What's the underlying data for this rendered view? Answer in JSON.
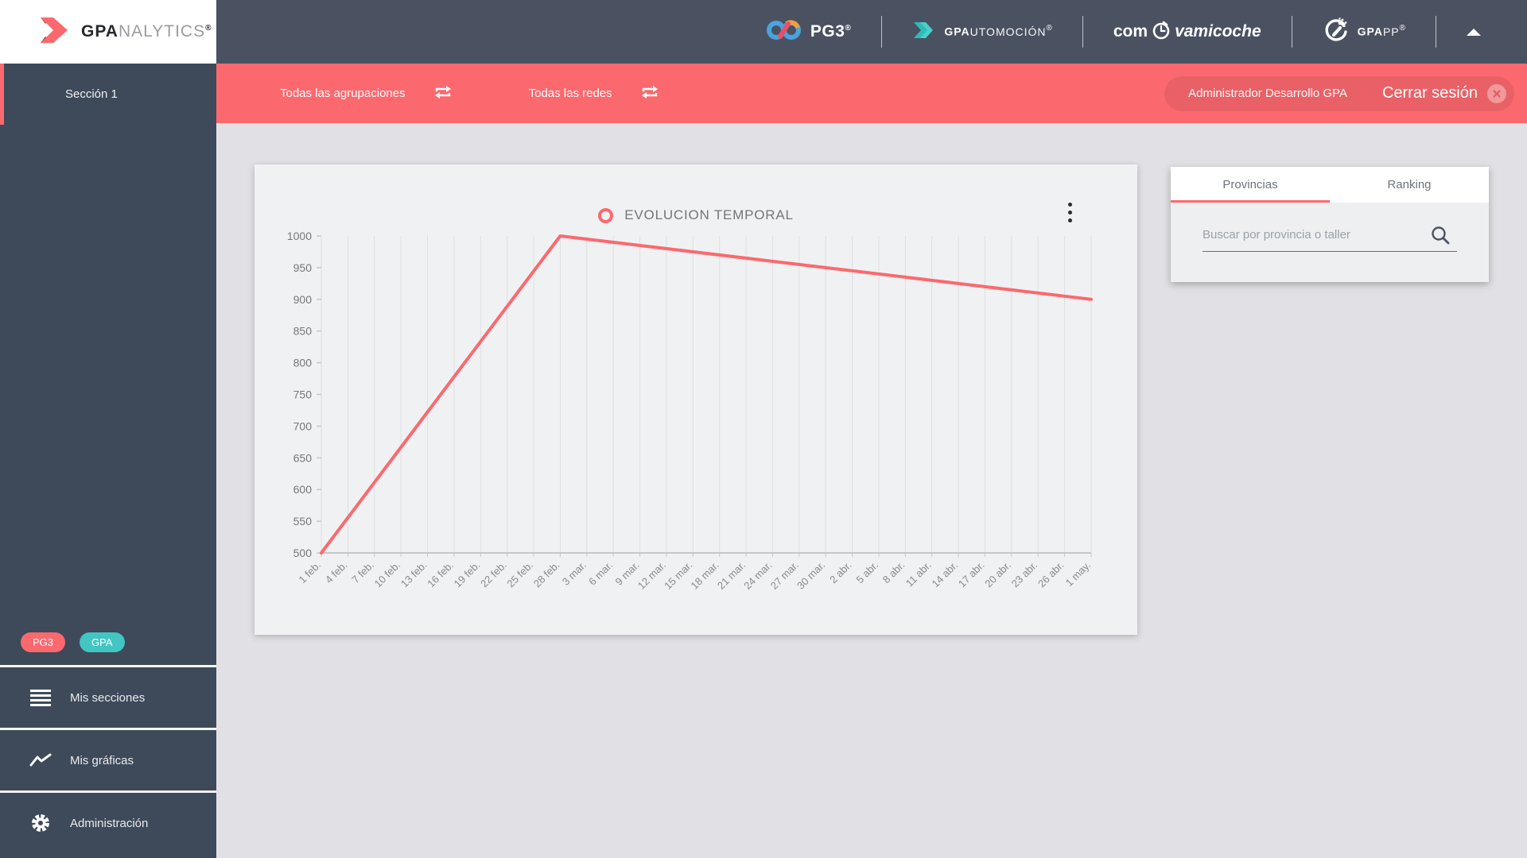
{
  "header": {
    "logos": [
      {
        "name": "PG3",
        "text": "PG3",
        "reg": "®"
      },
      {
        "name": "GP Automoción",
        "bold": "GPA",
        "light": "UTOMOCIÓN",
        "reg": "®"
      },
      {
        "name": "comprovamicoche",
        "pre": "com",
        "post": "vamicoche"
      },
      {
        "name": "GPA APP",
        "bold": "GPA",
        "light": "PP",
        "reg": "®"
      }
    ]
  },
  "sidebar": {
    "logo": {
      "bold": "GPA",
      "light": "NALYTICS",
      "reg": "®"
    },
    "section": {
      "label": "Sección 1"
    },
    "badges": [
      {
        "label": "PG3",
        "color": "#fb696e"
      },
      {
        "label": "GPA",
        "color": "#41c6c3"
      }
    ],
    "menu": [
      {
        "label": "Mis secciones",
        "icon": "menu-lines-icon"
      },
      {
        "label": "Mis gráficas",
        "icon": "line-chart-icon"
      },
      {
        "label": "Administración",
        "icon": "gear-icon"
      }
    ]
  },
  "filterbar": {
    "filters": [
      {
        "label": "Todas las agrupaciones",
        "icon": "swap-arrows-icon"
      },
      {
        "label": "Todas las redes",
        "icon": "swap-arrows-icon"
      }
    ],
    "user_label": "Administrador Desarrollo GPA",
    "logout_label": "Cerrar sesión"
  },
  "panel": {
    "tabs": [
      {
        "label": "Provincias",
        "active": true
      },
      {
        "label": "Ranking",
        "active": false
      }
    ],
    "search_placeholder": "Buscar por provincia o taller"
  },
  "chart_data": {
    "type": "line",
    "title": "EVOLUCION TEMPORAL",
    "legend": {
      "label": "EVOLUCION TEMPORAL",
      "position": "top-center",
      "marker": "open-circle"
    },
    "categories": [
      "1 feb.",
      "4 feb.",
      "7 feb.",
      "10 feb.",
      "13 feb.",
      "16 feb.",
      "19 feb.",
      "22 feb.",
      "25 feb.",
      "28 feb.",
      "3 mar.",
      "6 mar.",
      "9 mar.",
      "12 mar.",
      "15 mar.",
      "18 mar.",
      "21 mar.",
      "24 mar.",
      "27 mar.",
      "30 mar.",
      "2 abr.",
      "5 abr.",
      "8 abr.",
      "11 abr.",
      "14 abr.",
      "17 abr.",
      "20 abr.",
      "23 abr.",
      "26 abr.",
      "1 may."
    ],
    "series": [
      {
        "name": "EVOLUCION TEMPORAL",
        "color": "#fb696e",
        "points": [
          {
            "x": "1 feb.",
            "y": 500
          },
          {
            "x": "28 feb.",
            "y": 1000
          },
          {
            "x": "1 may.",
            "y": 900
          }
        ]
      }
    ],
    "ylim": [
      500,
      1000
    ],
    "ytick_step": 50,
    "grid": "vertical-only",
    "xlabel": "",
    "ylabel": "",
    "style": {
      "grid": "#dfdfe2",
      "axis": "#c7c7ca",
      "tick_text": "#8a8a8e",
      "ytick_text": "#77777b"
    }
  },
  "colors": {
    "accent_red": "#fb696e",
    "teal": "#41c6c3",
    "header_bg": "#4a5262",
    "sidebar_bg": "#3e4a5a",
    "page_bg": "#e1e1e5",
    "card_bg": "#f0f1f3",
    "panel_body_bg": "#edeff1"
  }
}
